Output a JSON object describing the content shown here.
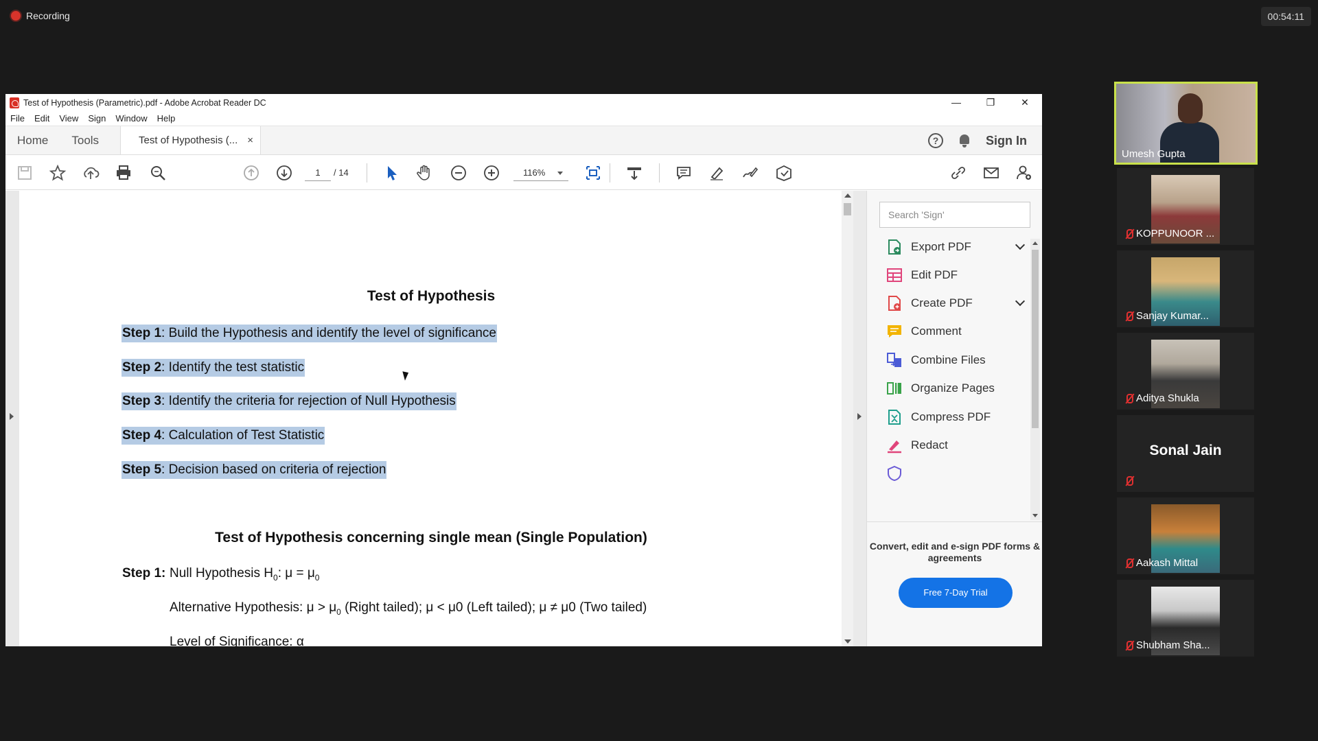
{
  "recording": {
    "label": "Recording"
  },
  "timer": "00:54:11",
  "acrobat": {
    "window_title": "Test of Hypothesis (Parametric).pdf - Adobe Acrobat Reader DC",
    "menu": [
      "File",
      "Edit",
      "View",
      "Sign",
      "Window",
      "Help"
    ],
    "tabs": {
      "home": "Home",
      "tools": "Tools",
      "document": "Test of Hypothesis (...",
      "close": "×"
    },
    "sign_in": "Sign In",
    "toolbar": {
      "page_current": "1",
      "page_total": "/ 14",
      "zoom": "116%"
    },
    "document": {
      "title": "Test of Hypothesis",
      "steps": [
        {
          "label": "Step 1",
          "text": ": Build the Hypothesis and identify the level of significance"
        },
        {
          "label": "Step 2",
          "text": ": Identify the test statistic"
        },
        {
          "label": "Step 3",
          "text": ": Identify the criteria for rejection of Null Hypothesis"
        },
        {
          "label": "Step 4",
          "text": ": Calculation of Test Statistic"
        },
        {
          "label": "Step 5",
          "text": ": Decision based on criteria of rejection"
        }
      ],
      "section_title": "Test of Hypothesis concerning single mean (Single Population)",
      "section_step_label": "Step 1:",
      "null_hypothesis": "Null Hypothesis H",
      "null_hypothesis_rest": ": μ = μ",
      "alt_hypothesis_1": "Alternative Hypothesis: μ > μ",
      "alt_hypothesis_2": " (Right tailed); μ < μ0 (Left tailed); μ ≠ μ0 (Two tailed)",
      "sub_zero": "0",
      "level_line": "Level of Significance: α"
    },
    "tools_pane": {
      "search_placeholder": "Search 'Sign'",
      "items": [
        {
          "label": "Export PDF",
          "color": "#2b8a5e",
          "icon": "export-pdf-icon",
          "chevron": true
        },
        {
          "label": "Edit PDF",
          "color": "#e0457b",
          "icon": "edit-pdf-icon",
          "chevron": false
        },
        {
          "label": "Create PDF",
          "color": "#e04848",
          "icon": "create-pdf-icon",
          "chevron": true
        },
        {
          "label": "Comment",
          "color": "#f2b400",
          "icon": "comment-icon",
          "chevron": false
        },
        {
          "label": "Combine Files",
          "color": "#4b5bd6",
          "icon": "combine-files-icon",
          "chevron": false
        },
        {
          "label": "Organize Pages",
          "color": "#3aa34a",
          "icon": "organize-pages-icon",
          "chevron": false
        },
        {
          "label": "Compress PDF",
          "color": "#1e9e8c",
          "icon": "compress-pdf-icon",
          "chevron": false
        },
        {
          "label": "Redact",
          "color": "#e0457b",
          "icon": "redact-icon",
          "chevron": false
        }
      ],
      "promo_text": "Convert, edit and e-sign PDF forms & agreements",
      "trial_button": "Free 7-Day Trial"
    }
  },
  "participants": [
    {
      "name": "Umesh Gupta"
    },
    {
      "name": "KOPPUNOOR ..."
    },
    {
      "name": "Sanjay Kumar..."
    },
    {
      "name": "Aditya Shukla"
    },
    {
      "name": "Sonal Jain"
    },
    {
      "name": "Aakash Mittal"
    },
    {
      "name": "Shubham Sha..."
    }
  ]
}
